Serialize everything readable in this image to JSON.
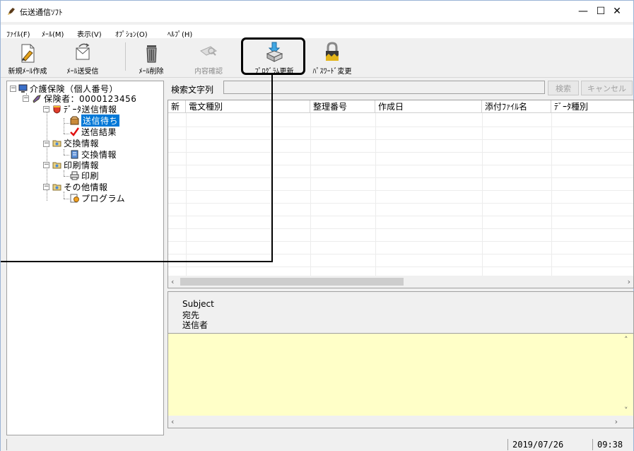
{
  "window": {
    "title": "伝送通信ｿﾌﾄ",
    "minimize_symbol": "—",
    "maximize_symbol": "☐",
    "close_symbol": "✕"
  },
  "menu": {
    "items": [
      {
        "label": "ﾌｧｲﾙ(F)"
      },
      {
        "label": "ﾒｰﾙ(M)"
      },
      {
        "label": "表示(V)"
      },
      {
        "label": "ｵﾌﾟｼｮﾝ(O)"
      },
      {
        "label": "ﾍﾙﾌﾟ(H)"
      }
    ]
  },
  "toolbar": {
    "buttons": [
      {
        "label": "新規ﾒｰﾙ作成",
        "icon": "new-mail-icon",
        "enabled": true
      },
      {
        "label": "ﾒｰﾙ送受信",
        "icon": "send-receive-icon",
        "enabled": true
      },
      {
        "label": "ﾒｰﾙ削除",
        "icon": "trash-icon",
        "enabled": true
      },
      {
        "label": "内容確認",
        "icon": "inspect-icon",
        "enabled": false
      },
      {
        "label": "ﾌﾟﾛｸﾞﾗﾑ更新",
        "icon": "program-update-icon",
        "enabled": true
      },
      {
        "label": "ﾊﾟｽﾜｰﾄﾞ変更",
        "icon": "lock-icon",
        "enabled": true
      }
    ]
  },
  "tree": {
    "root": "介護保険（個人番号）",
    "insurer": "保険者：0000123456",
    "data_send": "ﾃﾞｰﾀ送信情報",
    "waiting": "送信待ち",
    "result": "送信結果",
    "exchange": "交換情報",
    "exchange_child": "交換情報",
    "print": "印刷情報",
    "print_child": "印刷",
    "other": "その他情報",
    "program": "プログラム"
  },
  "search": {
    "label": "検索文字列",
    "value": "",
    "search_button": "検索",
    "cancel_button": "キャンセル"
  },
  "list": {
    "columns": [
      "新",
      "電文種別",
      "整理番号",
      "作成日",
      "添付ﾌｧｲﾙ名",
      "ﾃﾞｰﾀ種別"
    ],
    "rows": []
  },
  "detail": {
    "subject_label": "Subject",
    "to_label": "宛先",
    "sender_label": "送信者"
  },
  "statusbar": {
    "date": "2019/07/26",
    "time": "09:38"
  }
}
